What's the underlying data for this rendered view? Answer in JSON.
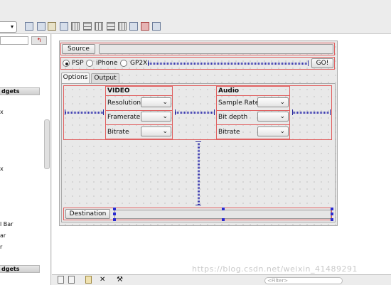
{
  "sidebar": {
    "categories": [
      "dgets",
      "dgets"
    ],
    "items": [
      "x",
      "x",
      "l Bar",
      "ar",
      "r"
    ]
  },
  "form": {
    "source_button": "Source",
    "devices": [
      {
        "label": "PSP",
        "selected": true
      },
      {
        "label": "iPhone",
        "selected": false
      },
      {
        "label": "GP2X",
        "selected": false
      }
    ],
    "go_button": "GO!",
    "tabs": [
      "Options",
      "Output"
    ],
    "active_tab": "Options",
    "video": {
      "title": "VIDEO",
      "rows": [
        "Resolution",
        "Framerate",
        "Bitrate"
      ]
    },
    "audio": {
      "title": "Audio",
      "rows": [
        "Sample Rate",
        "Bit depth",
        "Bitrate"
      ]
    },
    "destination_button": "Destination"
  },
  "bottom": {
    "filter_placeholder": "<Filter>"
  },
  "watermark": "https://blog.csdn.net/weixin_41489291",
  "colors": {
    "layout_border": "#e06060",
    "spacer": "#3a3ab0"
  },
  "icons": [
    "new-form-icon",
    "open-icon",
    "save-icon",
    "cut-icon",
    "copy-icon",
    "paste-icon",
    "tools-icon",
    "layout-horizontal-icon",
    "layout-vertical-icon",
    "break-layout-icon",
    "adjust-size-icon"
  ]
}
